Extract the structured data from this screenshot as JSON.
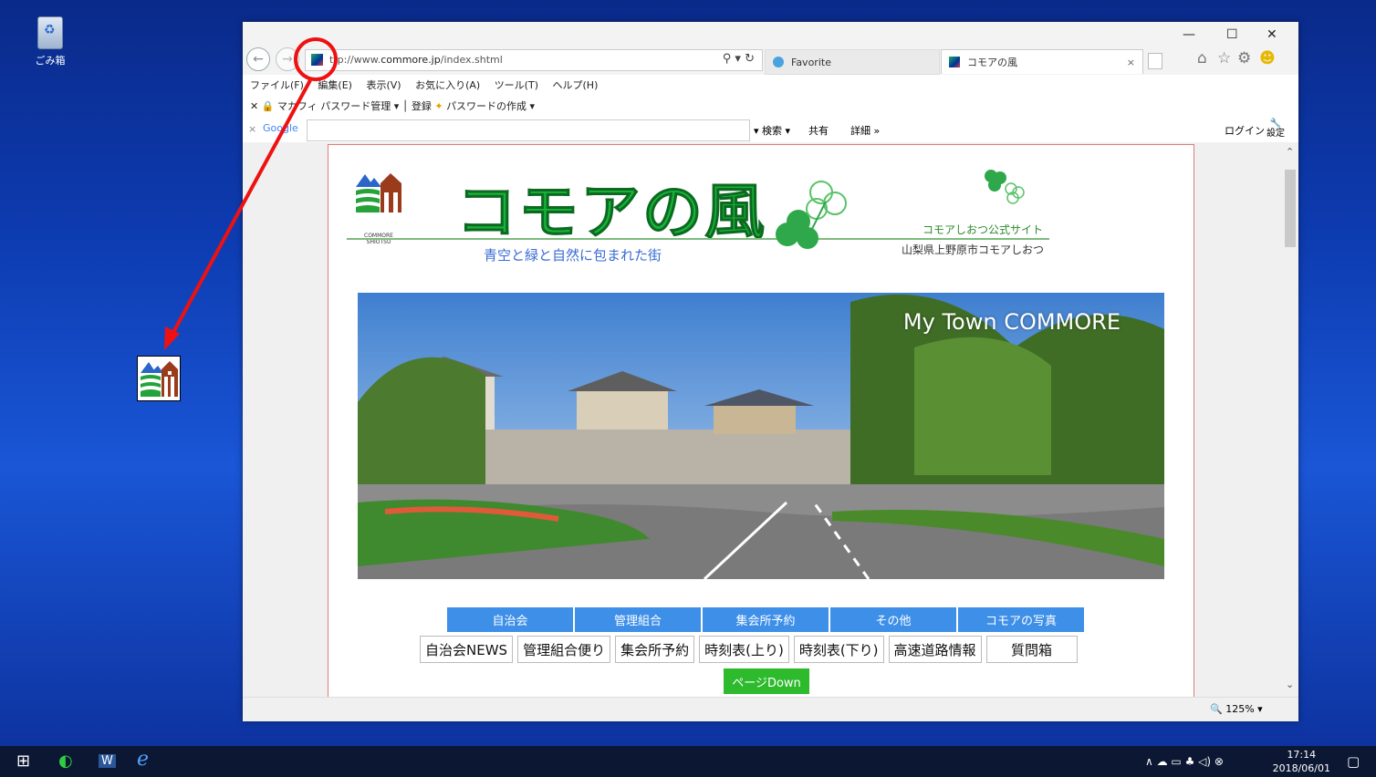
{
  "desktop": {
    "recycle_bin_label": "ごみ箱"
  },
  "browser": {
    "url_prefix": "ttp://www.",
    "url_domain": "commore.jp",
    "url_path": "/index.shtml",
    "tabs": [
      {
        "label": "Favorite"
      },
      {
        "label": "コモアの風"
      }
    ],
    "menu": [
      "ファイル(F)",
      "編集(E)",
      "表示(V)",
      "お気に入り(A)",
      "ツール(T)",
      "ヘルプ(H)"
    ],
    "toolbar2": {
      "item1": "マカフィ パスワード管理",
      "item2": "登録",
      "item3": "パスワードの作成"
    },
    "google_bar": {
      "brand": "Google",
      "search": "検索",
      "share": "共有",
      "details": "詳細",
      "login": "ログイン",
      "settings": "設定"
    },
    "zoom": "125%"
  },
  "page": {
    "logo_caption_1": "COMMORE",
    "logo_caption_2": "SHIOTSU",
    "title": "コモアの風",
    "tagline": "青空と緑と自然に包まれた街",
    "subtitle": "コモアしおつ公式サイト",
    "location": "山梨県上野原市コモアしおつ",
    "photo_caption": "My Town COMMORE",
    "nav_blue": [
      "自治会",
      "管理組合",
      "集会所予約",
      "その他",
      "コモアの写真"
    ],
    "nav_white": [
      "自治会NEWS",
      "管理組合便り",
      "集会所予約",
      "時刻表(上り)",
      "時刻表(下り)",
      "高速道路情報",
      "質問箱"
    ],
    "page_down": "ページDown"
  },
  "taskbar": {
    "time": "17:14",
    "date": "2018/06/01"
  },
  "colors": {
    "annotation_red": "#ee1111",
    "nav_blue": "#3e8fe8",
    "title_green": "#18b33a",
    "page_down_green": "#2dba2d"
  }
}
